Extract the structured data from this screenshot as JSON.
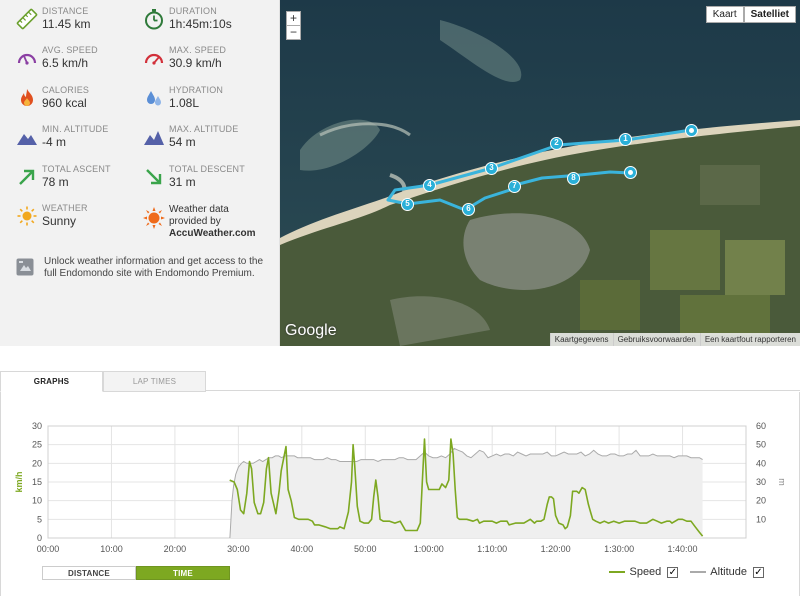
{
  "stats": [
    {
      "name": "distance",
      "label": "DISTANCE",
      "value": "11.45 km",
      "icon": "ruler-icon"
    },
    {
      "name": "duration",
      "label": "DURATION",
      "value": "1h:45m:10s",
      "icon": "stopwatch-icon"
    },
    {
      "name": "avg-speed",
      "label": "AVG. SPEED",
      "value": "6.5 km/h",
      "icon": "speedometer-icon"
    },
    {
      "name": "max-speed",
      "label": "MAX. SPEED",
      "value": "30.9 km/h",
      "icon": "speedometer-icon"
    },
    {
      "name": "calories",
      "label": "CALORIES",
      "value": "960 kcal",
      "icon": "flame-icon"
    },
    {
      "name": "hydration",
      "label": "HYDRATION",
      "value": "1.08L",
      "icon": "water-drops-icon"
    },
    {
      "name": "min-altitude",
      "label": "MIN. ALTITUDE",
      "value": "-4 m",
      "icon": "mountain-icon"
    },
    {
      "name": "max-altitude",
      "label": "MAX. ALTITUDE",
      "value": "54 m",
      "icon": "mountain-icon"
    },
    {
      "name": "total-ascent",
      "label": "TOTAL ASCENT",
      "value": "78 m",
      "icon": "arrow-up-right-icon"
    },
    {
      "name": "total-descent",
      "label": "TOTAL DESCENT",
      "value": "31 m",
      "icon": "arrow-down-right-icon"
    },
    {
      "name": "weather",
      "label": "WEATHER",
      "value": "Sunny",
      "icon": "sun-icon"
    }
  ],
  "weather_credit": {
    "line1": "Weather data",
    "line2": "provided by",
    "brand": "AccuWeather.com",
    "icon": "sun-badge-icon"
  },
  "unlock": {
    "text": "Unlock weather information and get access to the full Endomondo site with Endomondo Premium.",
    "icon": "premium-icon"
  },
  "map": {
    "zoom_in": "+",
    "zoom_out": "−",
    "types": [
      "Kaart",
      "Satelliet"
    ],
    "active_type": "Satelliet",
    "logo": "Google",
    "footer": [
      "Kaartgegevens",
      "Gebruiksvoorwaarden",
      "Een kaartfout rapporteren"
    ],
    "waypoints": [
      "1",
      "2",
      "3",
      "4",
      "5",
      "6",
      "7",
      "8"
    ],
    "route_color": "#3ab4dc"
  },
  "tabs": {
    "graphs": "GRAPHS",
    "laps": "LAP TIMES",
    "active": "GRAPHS"
  },
  "mode": {
    "distance": "DISTANCE",
    "time": "TIME",
    "active": "TIME"
  },
  "legend": {
    "speed": "Speed",
    "altitude": "Altitude",
    "speed_checked": "✓",
    "altitude_checked": "✓"
  },
  "chart_data": {
    "type": "line",
    "ylabel": "km/h",
    "ylabel_right": "m",
    "ylim": [
      0,
      30
    ],
    "ylim_right": [
      0,
      60
    ],
    "xlim": [
      0,
      6600
    ],
    "x_ticks": [
      "00:00",
      "10:00",
      "20:00",
      "30:00",
      "40:00",
      "50:00",
      "1:00:00",
      "1:10:00",
      "1:20:00",
      "1:30:00",
      "1:40:00"
    ],
    "y_ticks": [
      "0",
      "5",
      "10",
      "15",
      "20",
      "25",
      "30"
    ],
    "y_ticks_right": [
      "10",
      "20",
      "30",
      "40",
      "50",
      "60"
    ],
    "grid": true,
    "series": [
      {
        "name": "Speed",
        "axis": "left",
        "color": "#7da821",
        "points": [
          [
            1718,
            15.5
          ],
          [
            1760,
            15
          ],
          [
            1790,
            13
          ],
          [
            1820,
            7.5
          ],
          [
            1850,
            6.5
          ],
          [
            1880,
            12
          ],
          [
            1905,
            20.5
          ],
          [
            1925,
            18.5
          ],
          [
            1950,
            9.5
          ],
          [
            1985,
            6.5
          ],
          [
            2010,
            6.5
          ],
          [
            2040,
            9.5
          ],
          [
            2065,
            18.5
          ],
          [
            2085,
            21.5
          ],
          [
            2110,
            12
          ],
          [
            2130,
            9.5
          ],
          [
            2155,
            6.5
          ],
          [
            2185,
            12.5
          ],
          [
            2205,
            18
          ],
          [
            2230,
            21.5
          ],
          [
            2250,
            24.5
          ],
          [
            2270,
            13
          ],
          [
            2300,
            10
          ],
          [
            2330,
            5.5
          ],
          [
            2370,
            5
          ],
          [
            2420,
            5
          ],
          [
            2460,
            5
          ],
          [
            2500,
            4.5
          ],
          [
            2520,
            3.5
          ],
          [
            2560,
            3.5
          ],
          [
            2620,
            3
          ],
          [
            2670,
            2.5
          ],
          [
            2740,
            2.5
          ],
          [
            2760,
            3
          ],
          [
            2800,
            2.5
          ],
          [
            2840,
            7
          ],
          [
            2870,
            15
          ],
          [
            2885,
            25
          ],
          [
            2900,
            19.5
          ],
          [
            2925,
            8.5
          ],
          [
            2950,
            4.5
          ],
          [
            2990,
            4
          ],
          [
            3030,
            4
          ],
          [
            3060,
            5
          ],
          [
            3080,
            11
          ],
          [
            3100,
            15.5
          ],
          [
            3120,
            11
          ],
          [
            3140,
            5
          ],
          [
            3170,
            4.5
          ],
          [
            3230,
            4.5
          ],
          [
            3280,
            4
          ],
          [
            3330,
            4.5
          ],
          [
            3380,
            2
          ],
          [
            3440,
            2
          ],
          [
            3490,
            2
          ],
          [
            3520,
            4
          ],
          [
            3540,
            15.5
          ],
          [
            3560,
            26.5
          ],
          [
            3580,
            15
          ],
          [
            3600,
            13
          ],
          [
            3625,
            13
          ],
          [
            3650,
            13
          ],
          [
            3680,
            13
          ],
          [
            3700,
            13
          ],
          [
            3725,
            14.5
          ],
          [
            3760,
            13.5
          ],
          [
            3790,
            15.5
          ],
          [
            3810,
            26.5
          ],
          [
            3830,
            22.5
          ],
          [
            3850,
            13
          ],
          [
            3870,
            5.5
          ],
          [
            3890,
            5
          ],
          [
            3960,
            5
          ],
          [
            4020,
            4.5
          ],
          [
            4060,
            5
          ],
          [
            4080,
            4
          ],
          [
            4120,
            4.5
          ],
          [
            4200,
            4.5
          ],
          [
            4240,
            4
          ],
          [
            4280,
            4.5
          ],
          [
            4340,
            4.5
          ],
          [
            4360,
            3.5
          ],
          [
            4420,
            4
          ],
          [
            4500,
            4
          ],
          [
            4560,
            5
          ],
          [
            4600,
            4
          ],
          [
            4620,
            4.5
          ],
          [
            4660,
            4.5
          ],
          [
            4690,
            5
          ],
          [
            4720,
            9
          ],
          [
            4740,
            11
          ],
          [
            4760,
            11
          ],
          [
            4780,
            10.5
          ],
          [
            4800,
            6
          ],
          [
            4830,
            4
          ],
          [
            4870,
            3.5
          ],
          [
            4890,
            2.5
          ],
          [
            4910,
            3
          ],
          [
            4940,
            6
          ],
          [
            4960,
            12.5
          ],
          [
            5000,
            12.5
          ],
          [
            5020,
            12
          ],
          [
            5050,
            13.5
          ],
          [
            5080,
            13
          ],
          [
            5110,
            9
          ],
          [
            5130,
            7
          ],
          [
            5150,
            5
          ],
          [
            5180,
            4.5
          ],
          [
            5220,
            4
          ],
          [
            5260,
            4.5
          ],
          [
            5300,
            4
          ],
          [
            5350,
            4.5
          ],
          [
            5400,
            4
          ],
          [
            5450,
            4.5
          ],
          [
            5500,
            4.5
          ],
          [
            5550,
            4.5
          ],
          [
            5600,
            4
          ],
          [
            5660,
            4
          ],
          [
            5720,
            5
          ],
          [
            5760,
            4.5
          ],
          [
            5800,
            4
          ],
          [
            5850,
            4.5
          ],
          [
            5880,
            4.5
          ],
          [
            5900,
            4
          ],
          [
            5960,
            5
          ],
          [
            6000,
            5
          ],
          [
            6040,
            4.5
          ],
          [
            6080,
            4.5
          ],
          [
            6120,
            3
          ],
          [
            6160,
            1.5
          ],
          [
            6190,
            0.5
          ]
        ]
      },
      {
        "name": "Altitude",
        "axis": "right",
        "color": "#aaaaaa",
        "points": [
          [
            1720,
            0
          ],
          [
            1740,
            20
          ],
          [
            1755,
            28
          ],
          [
            1775,
            34
          ],
          [
            1800,
            38
          ],
          [
            1830,
            40
          ],
          [
            1850,
            41
          ],
          [
            1880,
            40
          ],
          [
            1910,
            40
          ],
          [
            1940,
            40
          ],
          [
            1970,
            41
          ],
          [
            2000,
            42
          ],
          [
            2030,
            41
          ],
          [
            2060,
            42
          ],
          [
            2090,
            43
          ],
          [
            2120,
            43
          ],
          [
            2150,
            44
          ],
          [
            2180,
            44
          ],
          [
            2210,
            43
          ],
          [
            2240,
            44
          ],
          [
            2270,
            44
          ],
          [
            2300,
            44
          ],
          [
            2330,
            44
          ],
          [
            2360,
            43
          ],
          [
            2400,
            43
          ],
          [
            2440,
            43
          ],
          [
            2480,
            43
          ],
          [
            2520,
            42
          ],
          [
            2560,
            42
          ],
          [
            2600,
            42
          ],
          [
            2640,
            43
          ],
          [
            2680,
            42
          ],
          [
            2720,
            42
          ],
          [
            2760,
            41
          ],
          [
            2800,
            41
          ],
          [
            2840,
            41
          ],
          [
            2880,
            41
          ],
          [
            2920,
            41
          ],
          [
            2960,
            42
          ],
          [
            3000,
            42
          ],
          [
            3040,
            42
          ],
          [
            3080,
            42
          ],
          [
            3120,
            41
          ],
          [
            3160,
            42
          ],
          [
            3200,
            42
          ],
          [
            3240,
            42
          ],
          [
            3280,
            42
          ],
          [
            3320,
            43
          ],
          [
            3360,
            43
          ],
          [
            3400,
            42
          ],
          [
            3440,
            42
          ],
          [
            3480,
            42
          ],
          [
            3520,
            44
          ],
          [
            3560,
            46
          ],
          [
            3600,
            44
          ],
          [
            3640,
            43
          ],
          [
            3680,
            43
          ],
          [
            3720,
            44
          ],
          [
            3760,
            43
          ],
          [
            3800,
            45
          ],
          [
            3840,
            48
          ],
          [
            3880,
            47
          ],
          [
            3920,
            46
          ],
          [
            3960,
            44
          ],
          [
            4000,
            43
          ],
          [
            4040,
            45
          ],
          [
            4080,
            47
          ],
          [
            4120,
            46
          ],
          [
            4160,
            43
          ],
          [
            4200,
            44
          ],
          [
            4240,
            45
          ],
          [
            4280,
            44
          ],
          [
            4320,
            45
          ],
          [
            4360,
            45
          ],
          [
            4400,
            44
          ],
          [
            4440,
            46
          ],
          [
            4480,
            45
          ],
          [
            4520,
            44
          ],
          [
            4560,
            45
          ],
          [
            4600,
            45
          ],
          [
            4640,
            45
          ],
          [
            4680,
            45
          ],
          [
            4720,
            46
          ],
          [
            4760,
            44
          ],
          [
            4800,
            44
          ],
          [
            4840,
            45
          ],
          [
            4880,
            46
          ],
          [
            4920,
            45
          ],
          [
            4960,
            45
          ],
          [
            5000,
            45
          ],
          [
            5040,
            46
          ],
          [
            5080,
            44
          ],
          [
            5120,
            45
          ],
          [
            5160,
            47
          ],
          [
            5200,
            45
          ],
          [
            5240,
            44
          ],
          [
            5280,
            44
          ],
          [
            5320,
            45
          ],
          [
            5360,
            45
          ],
          [
            5400,
            44
          ],
          [
            5440,
            44
          ],
          [
            5480,
            45
          ],
          [
            5520,
            45
          ],
          [
            5560,
            47
          ],
          [
            5600,
            44
          ],
          [
            5640,
            44
          ],
          [
            5680,
            44
          ],
          [
            5720,
            45
          ],
          [
            5760,
            44
          ],
          [
            5800,
            44
          ],
          [
            5840,
            44
          ],
          [
            5880,
            44
          ],
          [
            5920,
            43
          ],
          [
            5960,
            44
          ],
          [
            6000,
            44
          ],
          [
            6040,
            44
          ],
          [
            6080,
            43
          ],
          [
            6120,
            43
          ],
          [
            6160,
            43
          ],
          [
            6190,
            42
          ]
        ]
      }
    ]
  }
}
